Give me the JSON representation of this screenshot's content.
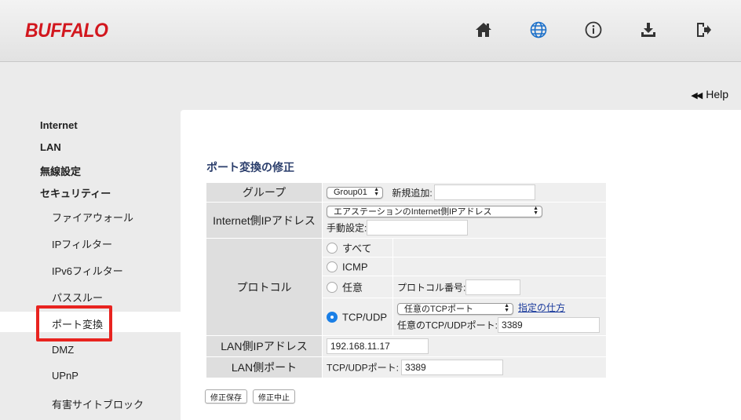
{
  "brand": {
    "logo_text": "BUFFALO",
    "accent": "#d2171e"
  },
  "header": {
    "icons": [
      "home-icon",
      "globe-icon",
      "info-icon",
      "download-icon",
      "logout-icon"
    ]
  },
  "help": {
    "label": "Help",
    "arrow": "◀◀"
  },
  "sidebar": {
    "top_items": [
      {
        "label": "Internet"
      },
      {
        "label": "LAN"
      },
      {
        "label": "無線設定"
      },
      {
        "label": "セキュリティー"
      }
    ],
    "sub_items": [
      {
        "label": "ファイアウォール"
      },
      {
        "label": "IPフィルター"
      },
      {
        "label": "IPv6フィルター"
      },
      {
        "label": "パススルー"
      },
      {
        "label": "ポート変換",
        "active": true
      },
      {
        "label": "DMZ"
      },
      {
        "label": "UPnP"
      },
      {
        "label": "有害サイトブロック"
      }
    ]
  },
  "page": {
    "title": "ポート変換の修正",
    "group": {
      "label": "グループ",
      "select": "Group01",
      "new_label": "新規追加:",
      "new_value": ""
    },
    "internet_ip": {
      "label": "Internet側IPアドレス",
      "select": "エアステーションのInternet側IPアドレス",
      "manual_label": "手動設定:",
      "manual_value": ""
    },
    "protocol": {
      "label": "プロトコル",
      "options": {
        "all": "すべて",
        "icmp": "ICMP",
        "any": "任意",
        "tcpudp": "TCP/UDP"
      },
      "selected": "TCP/UDP",
      "proto_no_label": "プロトコル番号:",
      "proto_no_value": "",
      "port_select": "任意のTCPポート",
      "how_link": "指定の仕方",
      "any_port_label": "任意のTCP/UDPポート:",
      "any_port_value": "3389"
    },
    "lan_ip": {
      "label": "LAN側IPアドレス",
      "value": "192.168.11.17"
    },
    "lan_port": {
      "label": "LAN側ポート",
      "port_label": "TCP/UDPポート:",
      "port_value": "3389"
    },
    "buttons": {
      "save": "修正保存",
      "cancel": "修正中止"
    }
  }
}
